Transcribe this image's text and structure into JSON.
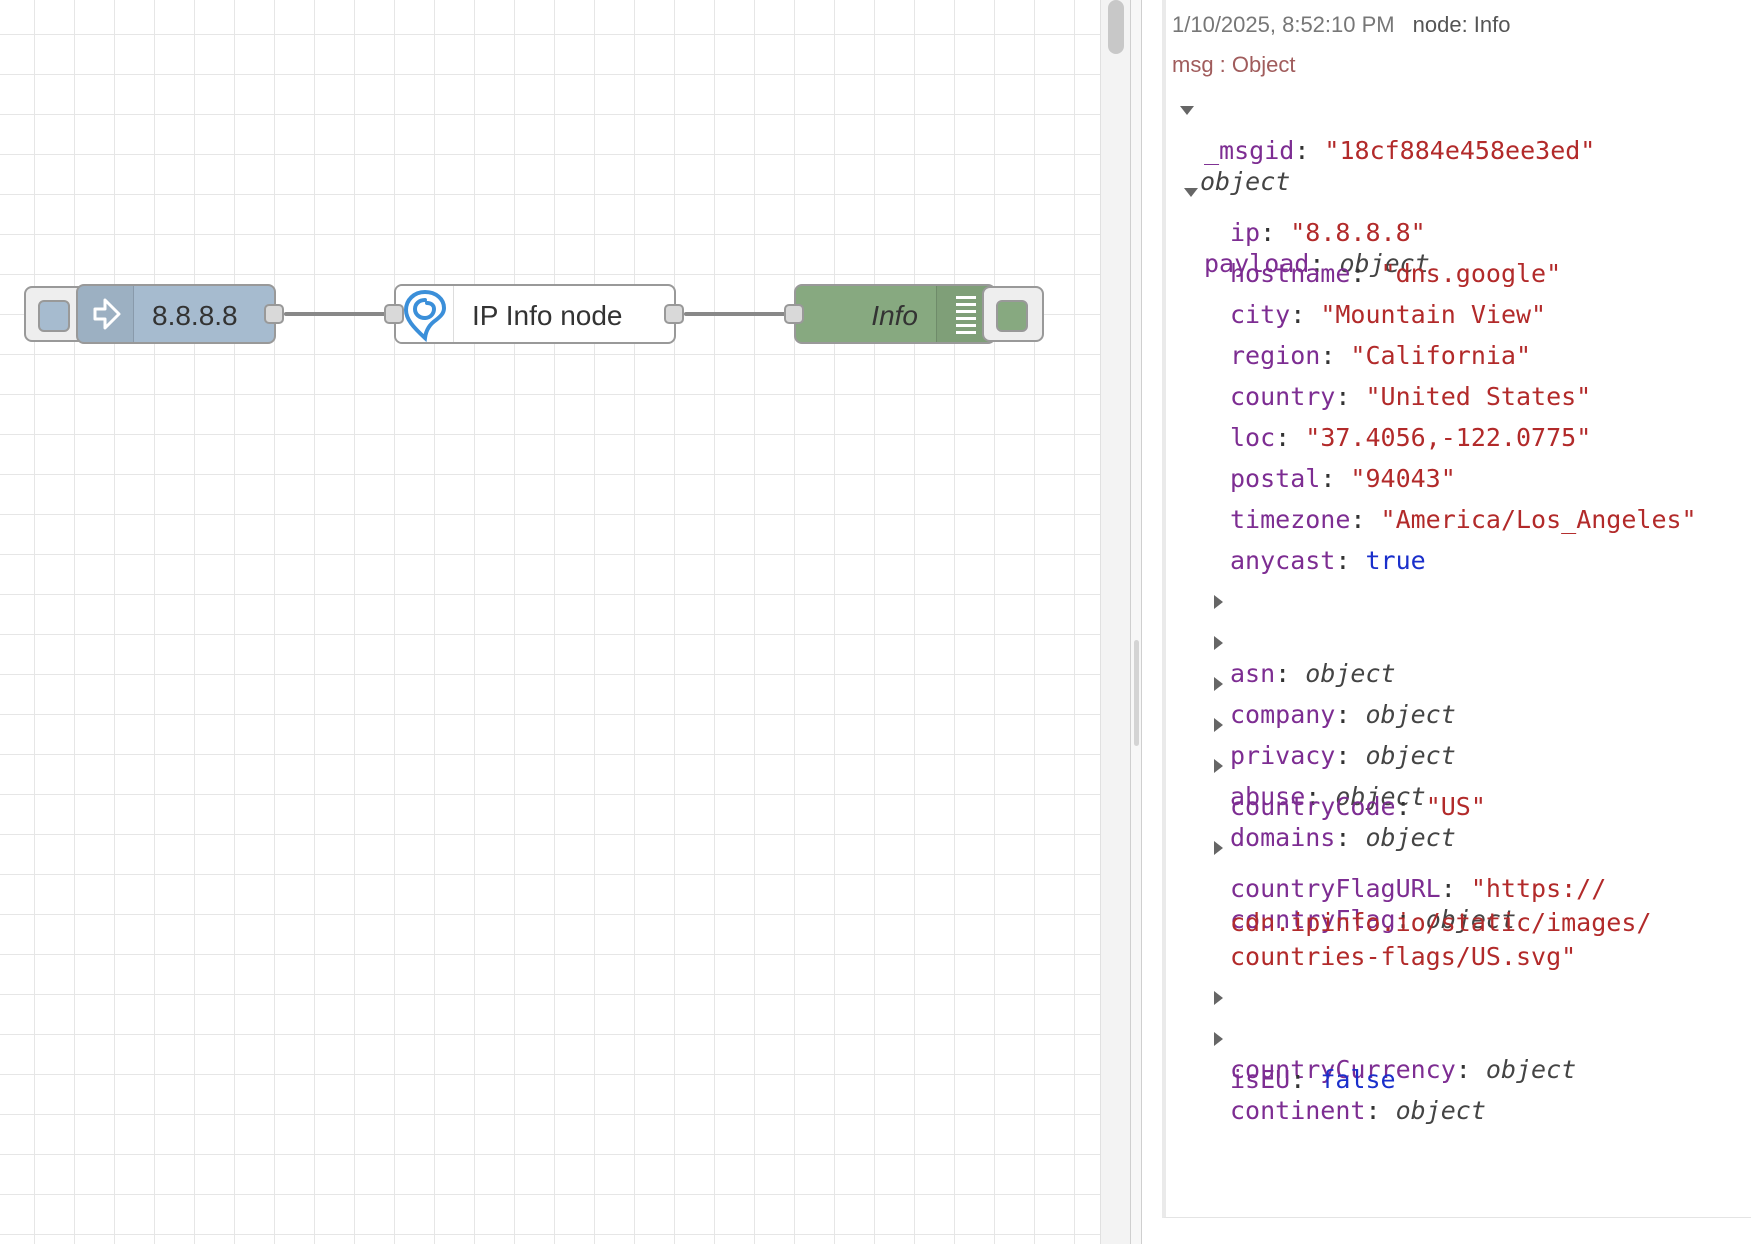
{
  "flow": {
    "inject_node": {
      "label": "8.8.8.8",
      "icon": "arrow-right-icon",
      "color": "#a6bbcf"
    },
    "ipinfo_node": {
      "label": "IP Info node",
      "icon": "ipinfo-pin-icon",
      "color": "#ffffff"
    },
    "debug_node": {
      "label": "Info",
      "icon": "list-icon",
      "color": "#87a980"
    }
  },
  "debug": {
    "timestamp": "1/10/2025, 8:52:10 PM",
    "node_label": "node: Info",
    "msg_type": "msg : Object",
    "root": "object",
    "msgid_key": "_msgid",
    "msgid_value": "\"18cf884e458ee3ed\"",
    "payload_key": "payload",
    "payload_type": "object",
    "fields": {
      "ip": {
        "key": "ip",
        "value": "\"8.8.8.8\""
      },
      "hostname": {
        "key": "hostname",
        "value": "\"dns.google\""
      },
      "city": {
        "key": "city",
        "value": "\"Mountain View\""
      },
      "region": {
        "key": "region",
        "value": "\"California\""
      },
      "country": {
        "key": "country",
        "value": "\"United States\""
      },
      "loc": {
        "key": "loc",
        "value": "\"37.4056,-122.0775\""
      },
      "postal": {
        "key": "postal",
        "value": "\"94043\""
      },
      "timezone": {
        "key": "timezone",
        "value": "\"America/Los_Angeles\""
      },
      "anycast": {
        "key": "anycast",
        "value": "true"
      },
      "asn": {
        "key": "asn",
        "value": "object"
      },
      "company": {
        "key": "company",
        "value": "object"
      },
      "privacy": {
        "key": "privacy",
        "value": "object"
      },
      "abuse": {
        "key": "abuse",
        "value": "object"
      },
      "domains": {
        "key": "domains",
        "value": "object"
      },
      "countryCode": {
        "key": "countryCode",
        "value": "\"US\""
      },
      "countryFlag": {
        "key": "countryFlag",
        "value": "object"
      },
      "countryFlagURL": {
        "key": "countryFlagURL",
        "value_line1": "\"https://",
        "value_line2": "cdn.ipinfo.io/static/images/",
        "value_line3": "countries-flags/US.svg\""
      },
      "countryCurrency": {
        "key": "countryCurrency",
        "value": "object"
      },
      "continent": {
        "key": "continent",
        "value": "object"
      },
      "isEU": {
        "key": "isEU",
        "value": "false"
      }
    }
  }
}
